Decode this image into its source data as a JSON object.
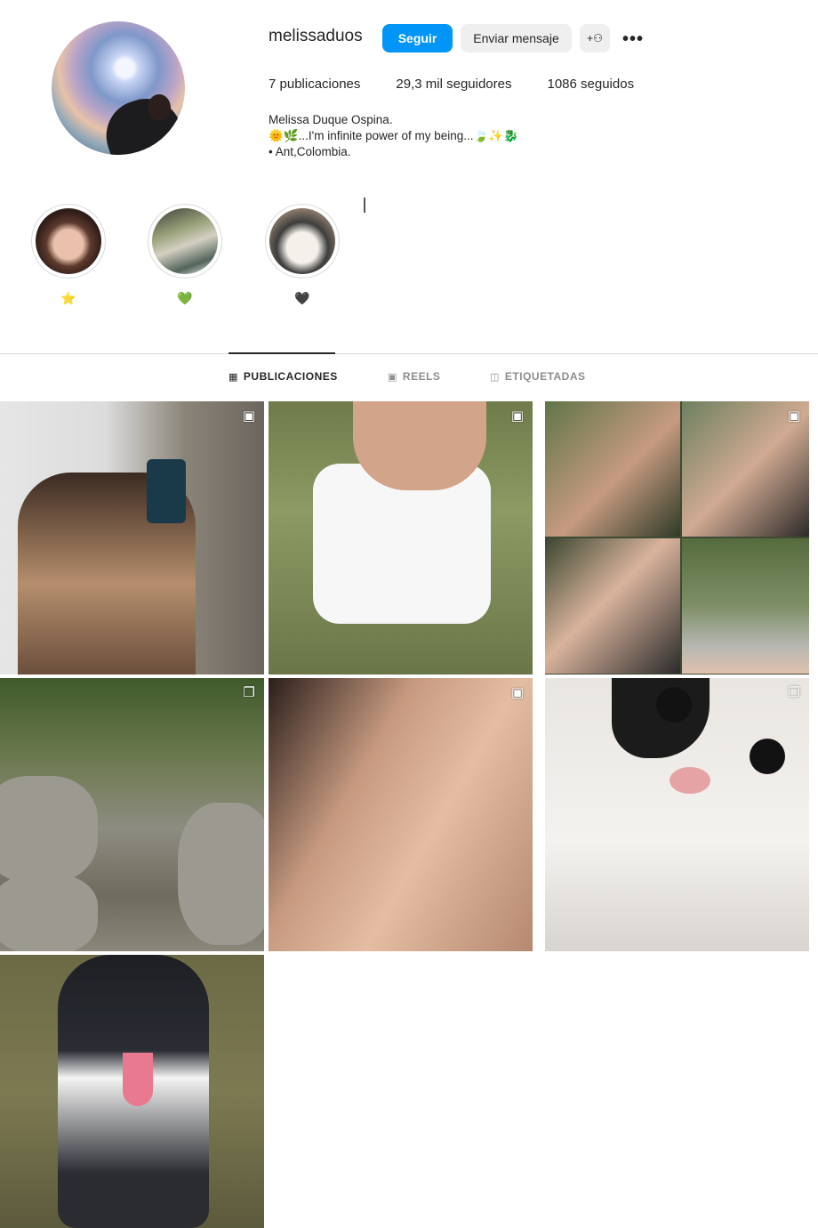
{
  "profile": {
    "username": "melissaduos",
    "follow_label": "Seguir",
    "message_label": "Enviar mensaje",
    "add_user_label": "+⚇",
    "more_label": "•••"
  },
  "stats": {
    "posts": "7 publicaciones",
    "followers": "29,3 mil seguidores",
    "following": "1086 seguidos"
  },
  "bio": {
    "name": "Melissa Duque Ospina.",
    "line2": "🌞🌿...I'm infinite power of my being...🍃✨🐉",
    "line3": "• Ant,Colombia."
  },
  "highlights": [
    {
      "label": "⭐",
      "icon": "star-icon"
    },
    {
      "label": "💚",
      "icon": "heart-icon"
    },
    {
      "label": "🖤",
      "icon": "heart-icon"
    }
  ],
  "tabs": {
    "posts": "PUBLICACIONES",
    "reels": "REELS",
    "tagged": "ETIQUETADAS"
  },
  "colors": {
    "accent": "#0095f6",
    "button_gray": "#efefef",
    "text": "#262626",
    "muted": "#8e8e8e"
  },
  "posts": [
    {
      "badge": "reel-icon"
    },
    {
      "badge": "reel-icon"
    },
    {
      "badge": "reel-icon"
    },
    {
      "badge": "carousel-icon"
    },
    {
      "badge": "reel-icon"
    },
    {
      "badge": "carousel-icon"
    },
    {
      "badge": ""
    }
  ],
  "badge_glyphs": {
    "reel": "▣",
    "carousel": "❐"
  }
}
